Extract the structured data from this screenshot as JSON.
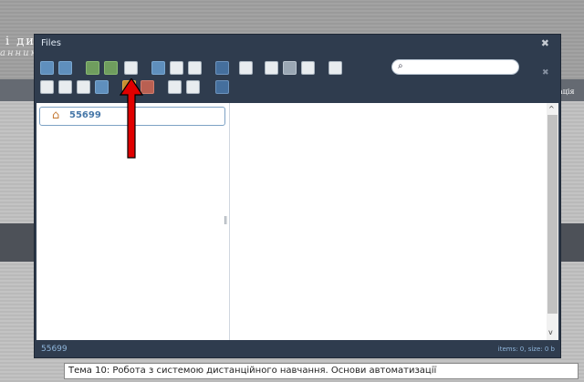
{
  "background": {
    "heading_fragment": "і ди",
    "subheading_fragment": "анник",
    "right_tab_fragment": "ація",
    "bottom_field_text": "Тема 10: Робота з системою дистанційного навчання. Основи автоматизації"
  },
  "dialog": {
    "title": "Files",
    "close_label": "✖",
    "toolbar": {
      "close_label": "✖",
      "search": {
        "placeholder": "",
        "value": ""
      }
    },
    "tree": {
      "root_label": "55699"
    },
    "status": {
      "path": "55699",
      "info": "items: 0, size: 0 b"
    }
  },
  "annotation": {
    "arrow_color": "#e00000"
  },
  "colors": {
    "dialog_bg": "#2f3c4e",
    "link_blue": "#4677a8",
    "status_text": "#8fb6dc"
  }
}
